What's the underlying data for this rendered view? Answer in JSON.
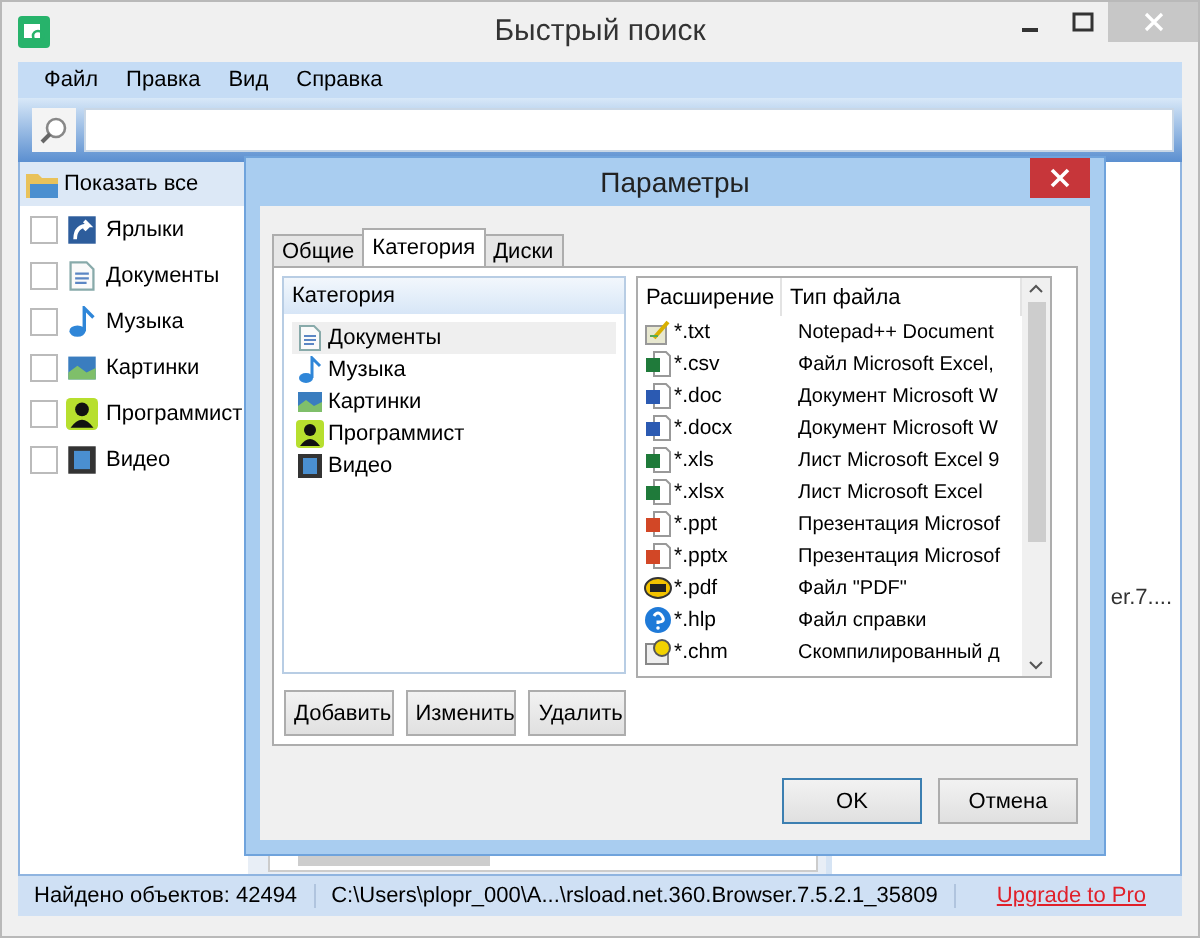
{
  "window": {
    "title": "Быстрый поиск"
  },
  "menu": [
    "Файл",
    "Правка",
    "Вид",
    "Справка"
  ],
  "sidebar": {
    "show_all": {
      "label": "Показать все",
      "selected": true
    },
    "items": [
      {
        "label": "Ярлыки",
        "checked": false,
        "kind": "shortcut"
      },
      {
        "label": "Документы",
        "checked": false,
        "kind": "document"
      },
      {
        "label": "Музыка",
        "checked": false,
        "kind": "music"
      },
      {
        "label": "Картинки",
        "checked": false,
        "kind": "image"
      },
      {
        "label": "Программист",
        "checked": false,
        "kind": "person"
      },
      {
        "label": "Видео",
        "checked": false,
        "kind": "video"
      }
    ]
  },
  "background_text": "er.7....",
  "dialog": {
    "title": "Параметры",
    "tabs": [
      {
        "label": "Общие",
        "selected": false
      },
      {
        "label": "Категория",
        "selected": true
      },
      {
        "label": "Диски",
        "selected": false
      }
    ],
    "categories": {
      "header": "Категория",
      "items": [
        {
          "label": "Документы",
          "kind": "document",
          "selected": true
        },
        {
          "label": "Музыка",
          "kind": "music",
          "selected": false
        },
        {
          "label": "Картинки",
          "kind": "image",
          "selected": false
        },
        {
          "label": "Программист",
          "kind": "person",
          "selected": false
        },
        {
          "label": "Видео",
          "kind": "video",
          "selected": false
        }
      ]
    },
    "category_buttons": [
      "Добавить",
      "Изменить",
      "Удалить"
    ],
    "extensions": {
      "columns": [
        "Расширение",
        "Тип файла"
      ],
      "rows": [
        {
          "ext": "*.txt",
          "type": "Notepad++ Document",
          "kind": "text"
        },
        {
          "ext": "*.csv",
          "type": "Файл Microsoft Excel,",
          "kind": "excel"
        },
        {
          "ext": "*.doc",
          "type": "Документ Microsoft W",
          "kind": "word"
        },
        {
          "ext": "*.docx",
          "type": "Документ Microsoft W",
          "kind": "word"
        },
        {
          "ext": "*.xls",
          "type": "Лист Microsoft Excel 9",
          "kind": "excel"
        },
        {
          "ext": "*.xlsx",
          "type": "Лист Microsoft Excel",
          "kind": "excel"
        },
        {
          "ext": "*.ppt",
          "type": "Презентация Microsof",
          "kind": "powerpoint"
        },
        {
          "ext": "*.pptx",
          "type": "Презентация Microsof",
          "kind": "powerpoint"
        },
        {
          "ext": "*.pdf",
          "type": "Файл \"PDF\"",
          "kind": "pdf"
        },
        {
          "ext": "*.hlp",
          "type": "Файл справки",
          "kind": "help"
        },
        {
          "ext": "*.chm",
          "type": "Скомпилированный д",
          "kind": "chm"
        }
      ]
    },
    "buttons": [
      {
        "label": "OK",
        "default": true
      },
      {
        "label": "Отмена",
        "default": false
      }
    ]
  },
  "status_bar": {
    "found": "Найдено объектов: 42494",
    "path": "C:\\Users\\plopr_000\\A...\\rsload.net.360.Browser.7.5.2.1_35809",
    "link": "Upgrade to Pro"
  }
}
